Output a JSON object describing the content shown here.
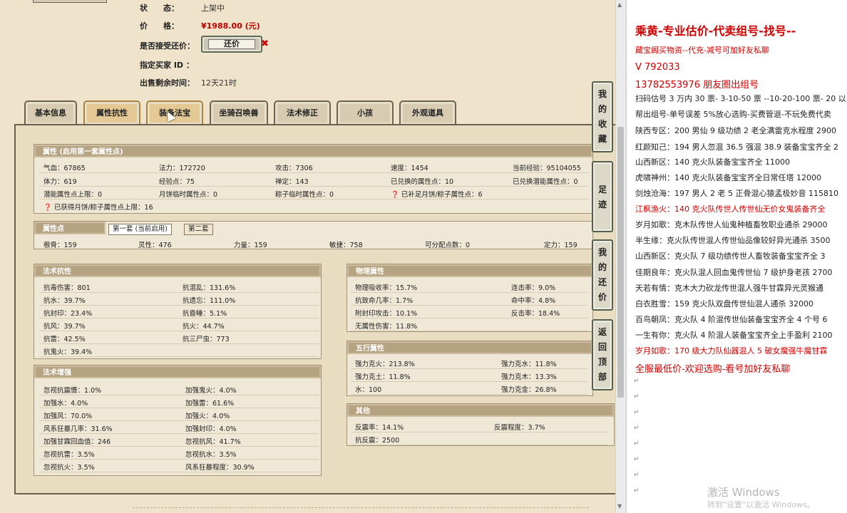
{
  "header": {
    "status_label": "状　　态：",
    "status_value": "上架中",
    "price_label": "价　　格：",
    "price_value": "¥1988.00 (元)",
    "counter_label": "是否接受还价：",
    "counter_button": "还价",
    "counter_mark": "✖",
    "buyer_label": "指定买家 ID ：",
    "buyer_value": "",
    "remaining_label": "出售剩余时间：",
    "remaining_value": "12天21时"
  },
  "tabs": [
    "基本信息",
    "属性抗性",
    "装备法宝",
    "坐骑召唤兽",
    "法术修正",
    "小孩",
    "外观道具"
  ],
  "attributes": {
    "title": "属性 (启用第一套属性点)",
    "rows": [
      [
        "气血：67865",
        "法力：172720",
        "攻击：7306",
        "速度：1454",
        "当前经验：95104055"
      ],
      [
        "体力：619",
        "经验点：75",
        "禅定：143",
        "已兑换的属性点：10",
        "已兑换潜能属性点：0"
      ],
      [
        "潜能属性点上限：0",
        "月饼临时属性点：0",
        "粽子临时属性点：0",
        "❓ 已补足月饼/粽子属性点：6",
        ""
      ]
    ],
    "note": "❓ 已获得月饼/粽子属性点上限：16"
  },
  "attr_points": {
    "title": "属性点",
    "subtab1": "第一套 (当前启用)",
    "subtab2": "第二套",
    "values": [
      "根骨：159",
      "灵性：476",
      "力量：159",
      "敏捷：758",
      "可分配点数：0",
      "定力：159"
    ]
  },
  "magic_resist": {
    "title": "法术抗性",
    "rows": [
      [
        "抗毒伤害：801",
        "抗混乱：131.6%"
      ],
      [
        "抗水：39.7%",
        "抗遗忘：111.0%"
      ],
      [
        "抗封印：23.4%",
        "抗昏睡：5.1%"
      ],
      [
        "抗风：39.7%",
        "抗火：44.7%"
      ],
      [
        "抗雷：42.5%",
        "抗三尸虫：773"
      ],
      [
        "抗鬼火：39.4%",
        ""
      ]
    ]
  },
  "magic_boost": {
    "title": "法术增强",
    "rows": [
      [
        "忽视抗震慑：1.0%",
        "加强鬼火：4.0%"
      ],
      [
        "加强水：4.0%",
        "加强雷：61.6%"
      ],
      [
        "加强风：70.0%",
        "加强火：4.0%"
      ],
      [
        "风系狂暴几率：31.6%",
        "加强封印：4.0%"
      ],
      [
        "加强甘霖回血值：246",
        "忽视抗风：41.7%"
      ],
      [
        "忽视抗雷：3.5%",
        "忽视抗水：3.5%"
      ],
      [
        "忽视抗火：3.5%",
        "风系狂暴程度：30.9%"
      ]
    ]
  },
  "physical": {
    "title": "物理属性",
    "rows": [
      [
        "物理吸收率：15.7%",
        "连击率：9.0%"
      ],
      [
        "抗致命几率：1.7%",
        "命中率：4.8%"
      ],
      [
        "附封印攻击：10.1%",
        "反击率：18.4%"
      ],
      [
        "无属性伤害：11.8%",
        ""
      ]
    ]
  },
  "five_elements": {
    "title": "五行属性",
    "rows": [
      [
        "强力克火：213.8%",
        "强力克水：11.8%"
      ],
      [
        "强力克土：11.8%",
        "强力克木：13.3%"
      ],
      [
        "水：100",
        "强力克金：26.8%"
      ]
    ]
  },
  "other": {
    "title": "其他",
    "rows": [
      [
        "反震率：14.1%",
        "反震程度：3.7%"
      ],
      [
        "抗反震：2500",
        ""
      ]
    ]
  },
  "side_buttons": [
    {
      "chars": [
        "我",
        "的",
        "收",
        "藏"
      ]
    },
    {
      "chars": [
        "足",
        "迹"
      ]
    },
    {
      "chars": [
        "我",
        "的",
        "还",
        "价"
      ]
    },
    {
      "chars": [
        "返",
        "回",
        "顶",
        "部"
      ]
    }
  ],
  "notes": {
    "title": "乘黄-专业估价-代卖组号-找号--",
    "lines": [
      {
        "text": "藏宝阁买物资--代充-减号可加好友私聊",
        "style": "red"
      },
      {
        "text": "V 792033",
        "style": "big"
      },
      {
        "text": "    13782553976 朋友圈出组号",
        "style": "big"
      },
      {
        "text": "扫码估号 3 万内 30 票- 3-10-50 票   --10-20-100 票- 20 以",
        "style": "normal"
      },
      {
        "text": "帮出组号-单号误差 5%放心选购-买费管退-不玩免费代卖",
        "style": "normal"
      },
      {
        "text": "陕西专区：200 男仙 9 级功绩 2 老全满雷克水程度 2900",
        "style": "normal"
      },
      {
        "text": "红颜知己：194 男人忽混 36.5 强混 38.9 装备宝宝齐全 2",
        "style": "normal"
      },
      {
        "text": "山西新区：140 克火队装备宝宝齐全 11000",
        "style": "normal"
      },
      {
        "text": "虎啸神州：140 克火队装备宝宝齐全日常任塔 12000",
        "style": "normal"
      },
      {
        "text": "剑烛沧海：197 男人 2 老 5 正骨混心猿孟极妙音 115810",
        "style": "normal"
      },
      {
        "text": "江枫渔火：140 克火队传世人传世仙无价女鬼装备齐全",
        "style": "red"
      },
      {
        "text": "岁月如歌：克木队传世人仙鬼种植畜牧职业通杀 29000",
        "style": "normal"
      },
      {
        "text": "半生缘：克火队传世混人传世仙品像较好异光通杀 3500",
        "style": "normal"
      },
      {
        "text": "山西新区：克火队 7 级功绩传世人畜牧装备宝宝齐全 3",
        "style": "normal"
      },
      {
        "text": "佳期良年：克火队混人回血鬼传世仙 7 级护身老孩 2700",
        "style": "normal"
      },
      {
        "text": "天若有情：克木大力砍龙传世混人强牛甘霖异光灵猴通",
        "style": "normal"
      },
      {
        "text": "白衣胜雪：159 克火队双盘传世仙混人通杀 32000",
        "style": "normal"
      },
      {
        "text": "百鸟朝凤：克火队 4 阶混传世仙装备宝宝齐全 4 个号 6",
        "style": "normal"
      },
      {
        "text": "一生有你：克火队 4 阶混人装备宝宝齐全上手盈利 2100",
        "style": "normal"
      },
      {
        "text": "岁月如歌：170 级大力队仙器混人 5 破女魔强牛魔甘霖",
        "style": "red"
      },
      {
        "text": "全服最低价-欢迎选购-看号加好友私聊",
        "style": "big"
      }
    ],
    "watermark1": "激活 Windows",
    "watermark2": "转到\"设置\"以激活 Windows。"
  }
}
